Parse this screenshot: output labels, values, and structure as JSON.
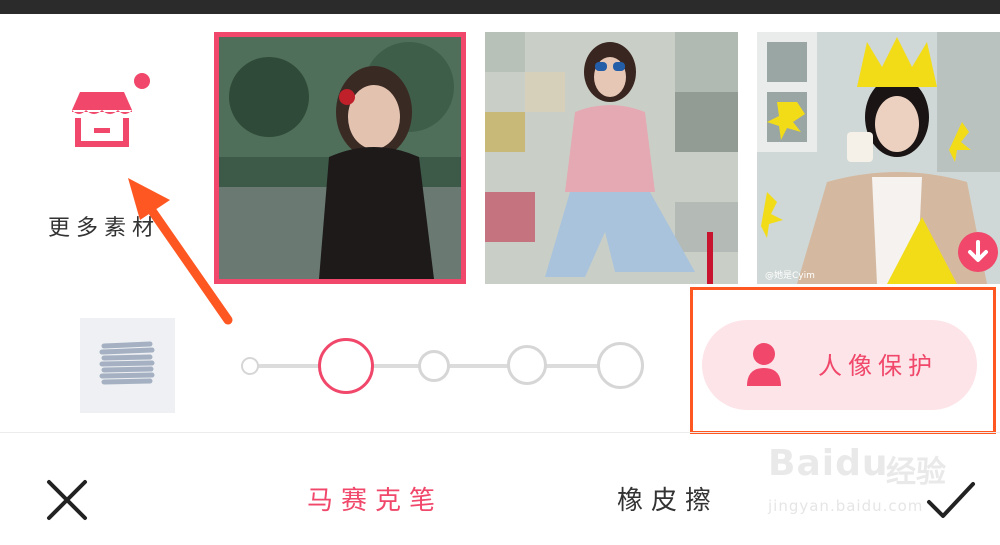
{
  "top_bar": {},
  "more_materials": {
    "label": "更多素材",
    "icon": "store-icon",
    "badge": "red-dot"
  },
  "styles": [
    {
      "name": "painting-style",
      "selected": true
    },
    {
      "name": "pixel-mosaic-style",
      "selected": false
    },
    {
      "name": "sticker-style",
      "selected": false,
      "download_icon": "download-icon",
      "credit": "@她是Cyim"
    }
  ],
  "brush": {
    "preview_icon": "scribble-icon"
  },
  "size_slider": {
    "levels": 5,
    "selected_index": 1
  },
  "portrait_protect": {
    "label": "人像保护",
    "icon": "person-icon"
  },
  "toolbar": {
    "close_icon": "close-icon",
    "mosaic_label": "马赛克笔",
    "eraser_label": "橡皮擦",
    "confirm_icon": "check-icon"
  },
  "watermark": {
    "text": "Baidu",
    "cn": "经验",
    "url": "jingyan.baidu.com"
  },
  "colors": {
    "accent": "#f0476a",
    "annotation": "#ff5722",
    "pill_bg": "#fde4e8"
  }
}
